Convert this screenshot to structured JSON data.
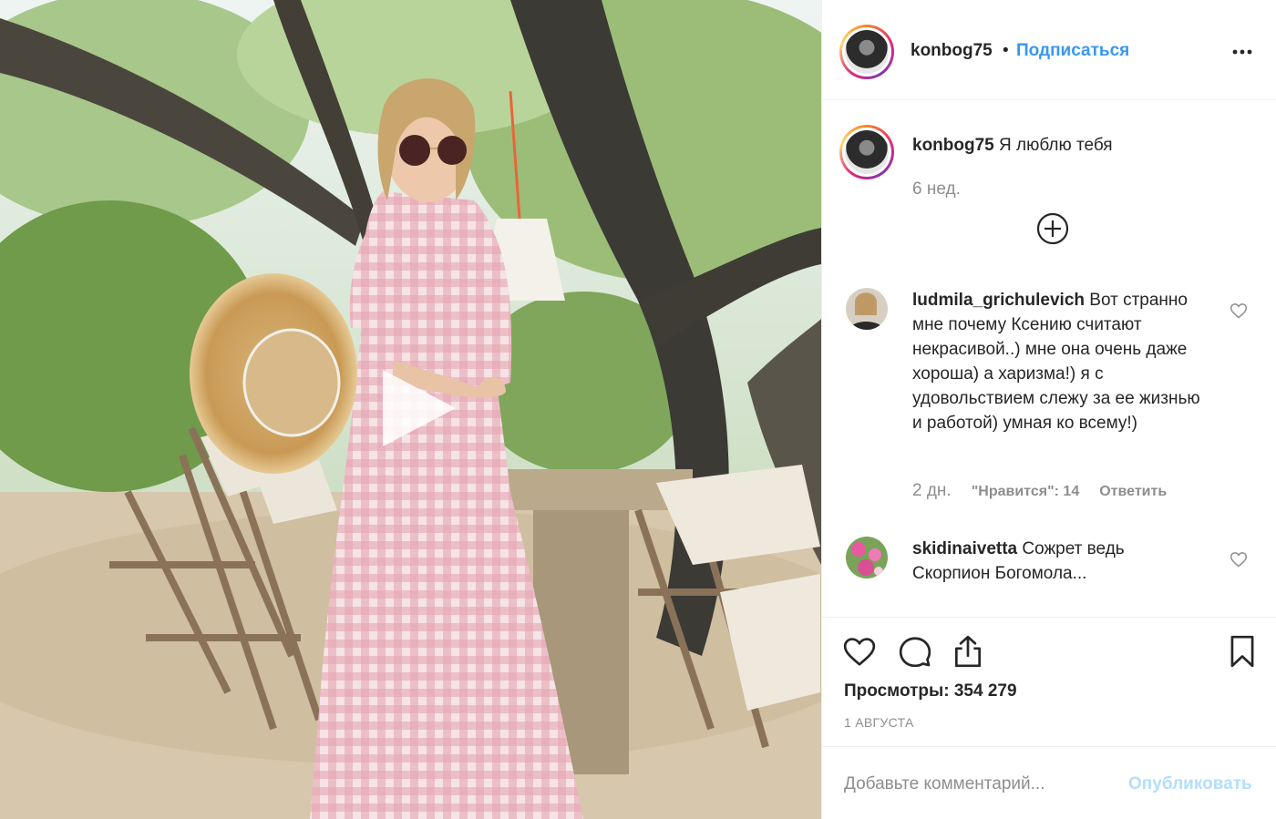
{
  "post": {
    "author": "konbog75",
    "separator": "•",
    "follow_label": "Подписаться",
    "caption_text": "Я люблю тебя",
    "caption_time": "6 нед."
  },
  "comments": [
    {
      "username": "ludmila_grichulevich",
      "text": "Вот странно мне почему Ксению считают некрасивой..) мне она очень даже хороша) а харизма!) я с удовольствием слежу за ее жизнью и работой) умная ко всему!)",
      "time": "2 дн.",
      "likes": "\"Нравится\": 14",
      "reply_label": "Ответить"
    },
    {
      "username": "skidinaivetta",
      "text": "Сожрет ведь Скорпион Богомола..."
    }
  ],
  "stats": {
    "views_label": "Просмотры: 354 279",
    "date": "1 АВГУСТА"
  },
  "composer": {
    "placeholder": "Добавьте комментарий...",
    "publish_label": "Опубликовать"
  },
  "icons": {
    "more": "more-horizontal-icon",
    "load_more": "plus-circle-icon",
    "like": "heart-icon",
    "comment": "comment-bubble-icon",
    "share": "share-upload-icon",
    "save": "bookmark-icon",
    "play": "play-icon"
  },
  "colors": {
    "link_blue": "#3897f0",
    "publish_disabled": "#b2dffc",
    "muted_text": "#8e8e8e",
    "border": "#efefef"
  }
}
